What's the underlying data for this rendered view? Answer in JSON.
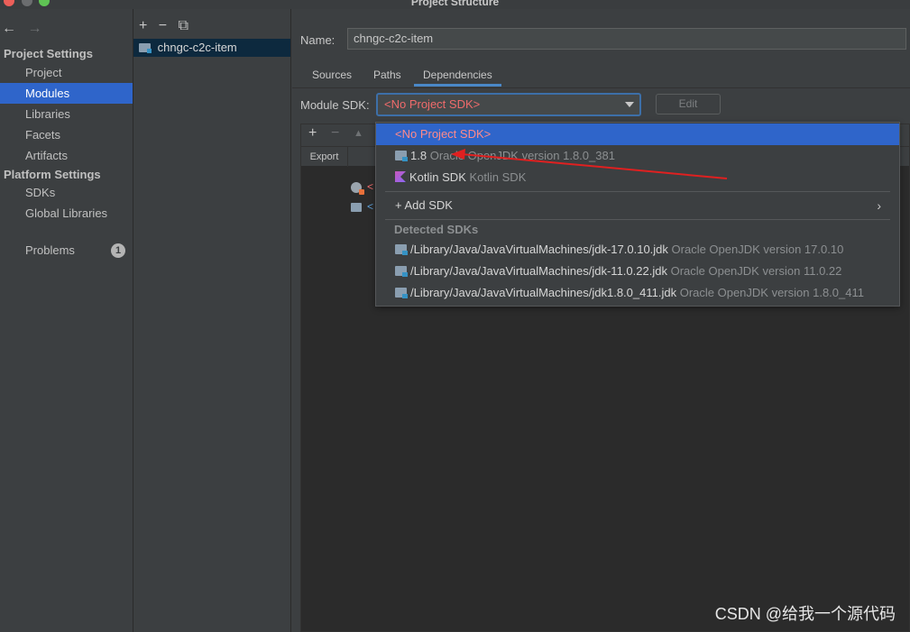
{
  "window": {
    "title": "Project Structure"
  },
  "nav": {
    "back": "←",
    "forward": "→"
  },
  "left": {
    "project_settings_header": "Project Settings",
    "project_items": [
      "Project",
      "Modules",
      "Libraries",
      "Facets",
      "Artifacts"
    ],
    "platform_settings_header": "Platform Settings",
    "platform_items": [
      "SDKs",
      "Global Libraries"
    ],
    "problems_label": "Problems",
    "problems_count": "1"
  },
  "middle": {
    "toolbar": {
      "add": "+",
      "remove": "−",
      "copy": "⧉"
    },
    "module_name": "chngc-c2c-item"
  },
  "right": {
    "name_label": "Name:",
    "name_value": "chngc-c2c-item",
    "tabs": [
      "Sources",
      "Paths",
      "Dependencies"
    ],
    "active_tab": "Dependencies",
    "module_sdk_label": "Module SDK:",
    "module_sdk_value": "<No Project SDK>",
    "edit_button": "Edit",
    "dep_toolbar": {
      "add": "+",
      "remove": "−",
      "up": "▲"
    },
    "export_header": "Export",
    "dep_rows": [
      "<",
      "<"
    ]
  },
  "popup": {
    "items": [
      {
        "label": "<No Project SDK>",
        "detail": ""
      },
      {
        "label": "1.8",
        "detail": "Oracle OpenJDK version 1.8.0_381"
      },
      {
        "label": "Kotlin SDK",
        "detail": "Kotlin SDK"
      }
    ],
    "add_sdk_label": "+ Add SDK",
    "add_sdk_chevron": "›",
    "detected_header": "Detected SDKs",
    "detected": [
      {
        "path": "/Library/Java/JavaVirtualMachines/jdk-17.0.10.jdk",
        "detail": "Oracle OpenJDK version 17.0.10"
      },
      {
        "path": "/Library/Java/JavaVirtualMachines/jdk-11.0.22.jdk",
        "detail": "Oracle OpenJDK version 11.0.22"
      },
      {
        "path": "/Library/Java/JavaVirtualMachines/jdk1.8.0_411.jdk",
        "detail": "Oracle OpenJDK version 1.8.0_411"
      }
    ]
  },
  "watermark": "CSDN @给我一个源代码",
  "colors": {
    "selection": "#2f65ca",
    "annotation_arrow": "#e02020",
    "error_text": "#ef6b6b"
  }
}
